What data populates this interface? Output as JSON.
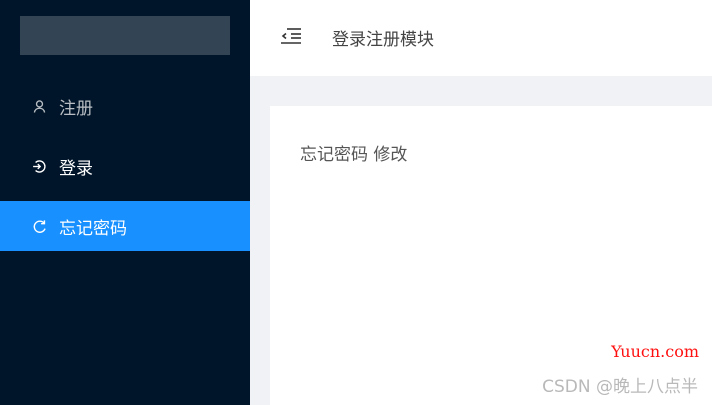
{
  "sidebar": {
    "items": [
      {
        "label": "注册",
        "icon": "user-icon",
        "active": false
      },
      {
        "label": "登录",
        "icon": "login-icon",
        "active": false
      },
      {
        "label": "忘记密码",
        "icon": "refresh-icon",
        "active": true
      }
    ]
  },
  "header": {
    "title": "登录注册模块",
    "toggle_icon": "menu-fold-icon"
  },
  "main": {
    "text": "忘记密码 修改"
  },
  "watermark": {
    "site": "Yuucn.com",
    "author": "CSDN @晚上八点半"
  },
  "colors": {
    "sidebar_bg": "#001529",
    "active_bg": "#1890ff",
    "page_bg": "#f0f2f5",
    "watermark_site": "#ff1010"
  }
}
